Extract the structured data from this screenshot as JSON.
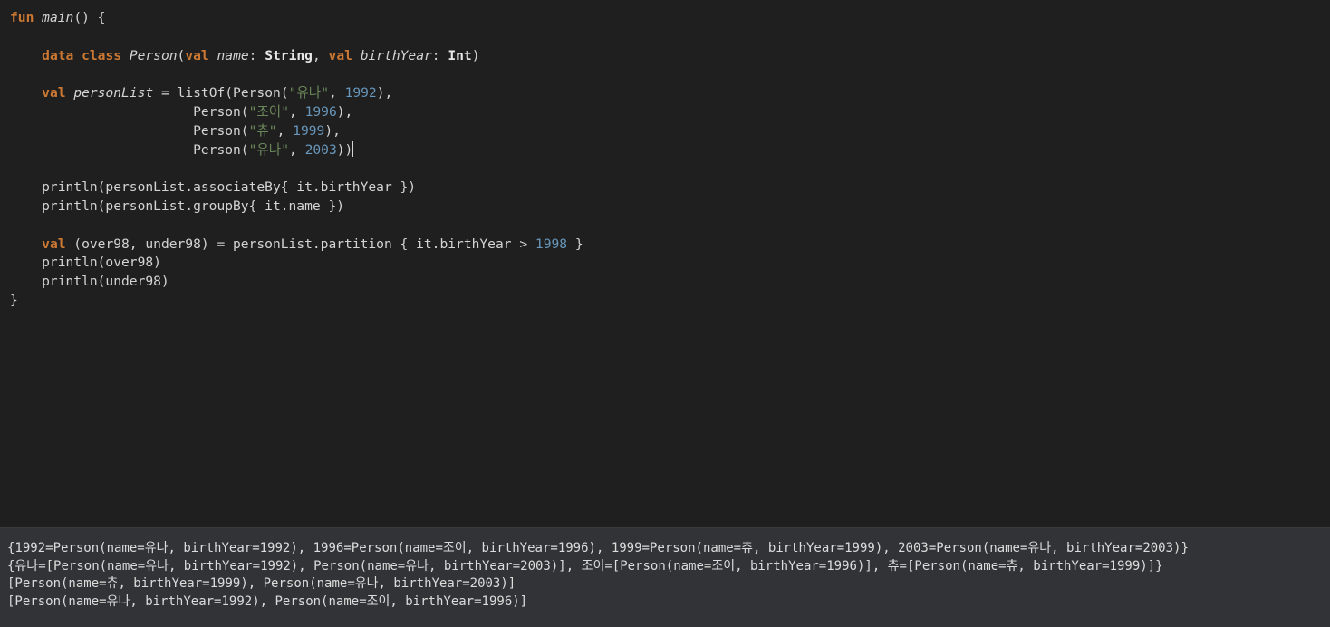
{
  "editor": {
    "lines": [
      [
        {
          "t": "fun",
          "k": "keyword"
        },
        {
          "t": " "
        },
        {
          "t": "main",
          "k": "fn"
        },
        {
          "t": "() {"
        }
      ],
      [],
      [
        {
          "t": "    "
        },
        {
          "t": "data class",
          "k": "keyword"
        },
        {
          "t": " "
        },
        {
          "t": "Person",
          "k": "class"
        },
        {
          "t": "("
        },
        {
          "t": "val",
          "k": "keyword"
        },
        {
          "t": " "
        },
        {
          "t": "name",
          "k": "prop"
        },
        {
          "t": ": "
        },
        {
          "t": "String",
          "k": "type"
        },
        {
          "t": ", "
        },
        {
          "t": "val",
          "k": "keyword"
        },
        {
          "t": " "
        },
        {
          "t": "birthYear",
          "k": "prop"
        },
        {
          "t": ": "
        },
        {
          "t": "Int",
          "k": "type"
        },
        {
          "t": ")"
        }
      ],
      [],
      [
        {
          "t": "    "
        },
        {
          "t": "val",
          "k": "keyword"
        },
        {
          "t": " "
        },
        {
          "t": "personList",
          "k": "prop"
        },
        {
          "t": " = listOf(Person("
        },
        {
          "t": "\"유나\"",
          "k": "string"
        },
        {
          "t": ", "
        },
        {
          "t": "1992",
          "k": "number"
        },
        {
          "t": "),"
        }
      ],
      [
        {
          "t": "                       Person("
        },
        {
          "t": "\"조이\"",
          "k": "string"
        },
        {
          "t": ", "
        },
        {
          "t": "1996",
          "k": "number"
        },
        {
          "t": "),"
        }
      ],
      [
        {
          "t": "                       Person("
        },
        {
          "t": "\"츄\"",
          "k": "string"
        },
        {
          "t": ", "
        },
        {
          "t": "1999",
          "k": "number"
        },
        {
          "t": "),"
        }
      ],
      [
        {
          "t": "                       Person("
        },
        {
          "t": "\"유나\"",
          "k": "string"
        },
        {
          "t": ", "
        },
        {
          "t": "2003",
          "k": "number"
        },
        {
          "t": "))"
        },
        {
          "caret": true
        }
      ],
      [],
      [
        {
          "t": "    println(personList.associateBy{ it.birthYear })"
        }
      ],
      [
        {
          "t": "    println(personList.groupBy{ it.name })"
        }
      ],
      [],
      [
        {
          "t": "    "
        },
        {
          "t": "val",
          "k": "keyword"
        },
        {
          "t": " (over98, under98) = personList.partition { it.birthYear > "
        },
        {
          "t": "1998",
          "k": "number"
        },
        {
          "t": " }"
        }
      ],
      [
        {
          "t": "    println(over98)"
        }
      ],
      [
        {
          "t": "    println(under98)"
        }
      ],
      [
        {
          "t": "}"
        }
      ]
    ]
  },
  "console": {
    "lines": [
      "{1992=Person(name=유나, birthYear=1992), 1996=Person(name=조이, birthYear=1996), 1999=Person(name=츄, birthYear=1999), 2003=Person(name=유나, birthYear=2003)}",
      "{유나=[Person(name=유나, birthYear=1992), Person(name=유나, birthYear=2003)], 조이=[Person(name=조이, birthYear=1996)], 츄=[Person(name=츄, birthYear=1999)]}",
      "[Person(name=츄, birthYear=1999), Person(name=유나, birthYear=2003)]",
      "[Person(name=유나, birthYear=1992), Person(name=조이, birthYear=1996)]"
    ]
  },
  "colors": {
    "editor_bg": "#1f1f1f",
    "console_bg": "#323336",
    "keyword": "#cc7832",
    "string": "#6a8759",
    "number": "#6897bb",
    "text": "#d4d4d4"
  }
}
